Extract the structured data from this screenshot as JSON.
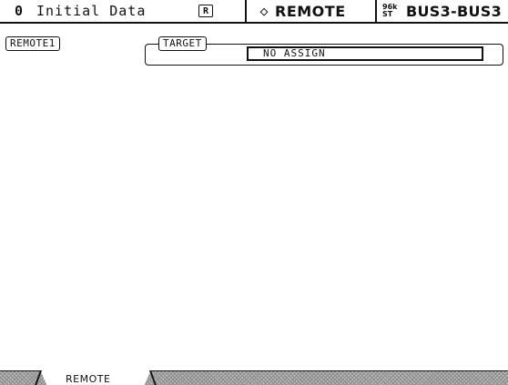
{
  "header": {
    "scene_number": "0",
    "scene_name": "Initial Data",
    "recall_icon_letter": "R",
    "diamond_symbol": "◇",
    "page_title": "REMOTE",
    "rate_top": "96k",
    "rate_bottom": "ST",
    "bus_label": "BUS3-BUS3"
  },
  "main": {
    "remote_label": "REMOTE1",
    "target_label": "TARGET",
    "target_value": "NO ASSIGN"
  },
  "tabs": [
    {
      "label": "REMOTE"
    }
  ]
}
